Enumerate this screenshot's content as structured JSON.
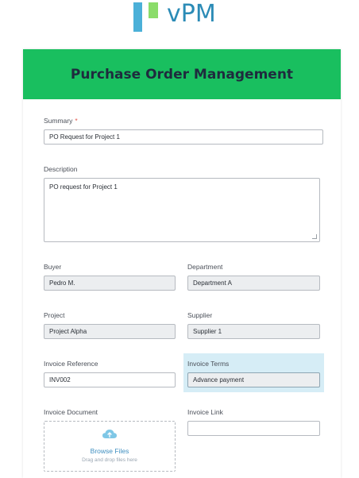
{
  "logo": {
    "text": "vPM"
  },
  "header": {
    "title": "Purchase Order Management"
  },
  "form": {
    "summary": {
      "label": "Summary",
      "required_mark": "*",
      "value": "PO Request for Project 1"
    },
    "description": {
      "label": "Description",
      "value": "PO request for Project 1"
    },
    "buyer": {
      "label": "Buyer",
      "value": "Pedro M."
    },
    "department": {
      "label": "Department",
      "value": "Department A"
    },
    "project": {
      "label": "Project",
      "value": "Project Alpha"
    },
    "supplier": {
      "label": "Supplier",
      "value": "Supplier 1"
    },
    "invoice_reference": {
      "label": "Invoice Reference",
      "value": "INV002"
    },
    "invoice_terms": {
      "label": "Invoice Terms",
      "value": "Advance payment"
    },
    "invoice_document": {
      "label": "Invoice Document",
      "browse_label": "Browse Files",
      "drop_hint": "Drag and drop files here"
    },
    "invoice_link": {
      "label": "Invoice Link",
      "value": ""
    }
  },
  "colors": {
    "header_bg": "#19bf5f",
    "focus_highlight": "#d6edf6",
    "logo_blue": "#4bb0d8",
    "logo_green": "#8bdc6a",
    "required": "#e2574c"
  },
  "icons": {
    "upload": "cloud-upload-icon"
  }
}
